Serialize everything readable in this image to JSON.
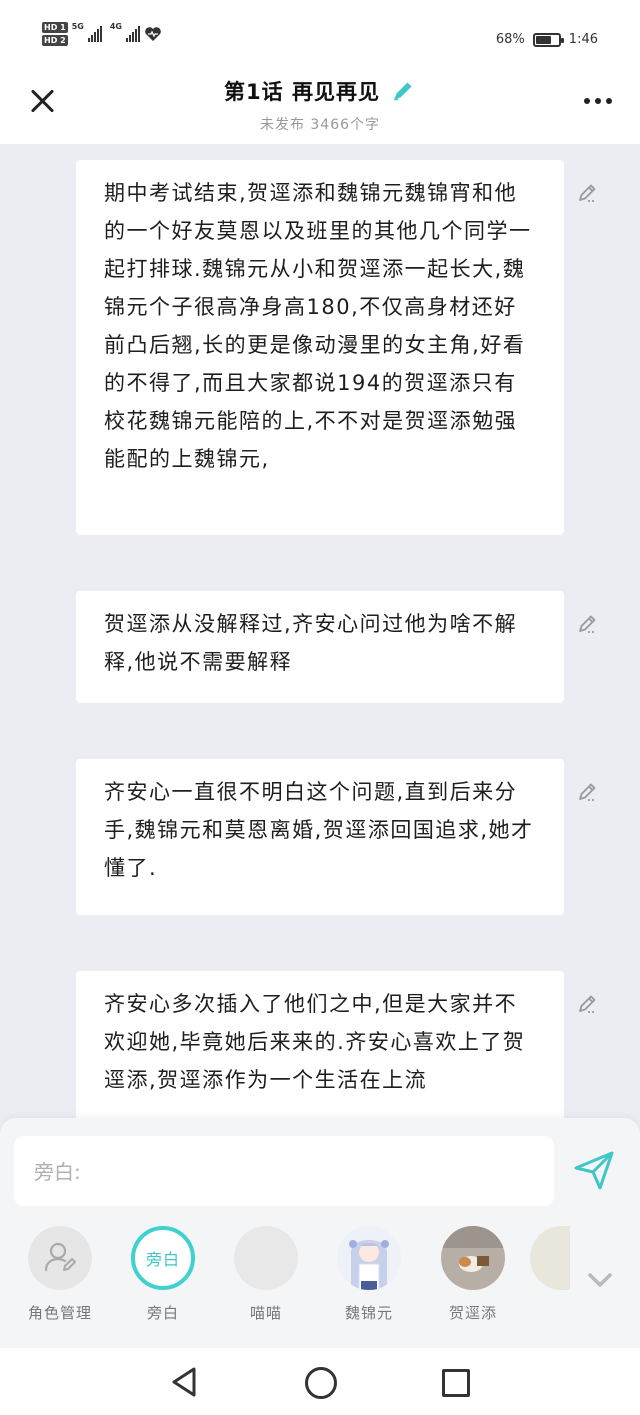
{
  "status_bar": {
    "hd1": "HD 1",
    "hd2": "HD 2",
    "network1": "5G",
    "network2": "4G",
    "battery_percent": "68%",
    "battery_level": 0.68,
    "time": "1:46"
  },
  "header": {
    "title": "第1话 再见再见",
    "subtitle": "未发布 3466个字"
  },
  "paragraphs": [
    {
      "text": "期中考试结束,贺逕添和魏锦元魏锦宵和他的一个好友莫恩以及班里的其他几个同学一起打排球.魏锦元从小和贺逕添一起长大,魏锦元个子很高净身高180,不仅高身材还好前凸后翘,长的更是像动漫里的女主角,好看的不得了,而且大家都说194的贺逕添只有校花魏锦元能陪的上,不不对是贺逕添勉强能配的上魏锦元,"
    },
    {
      "text": "贺逕添从没解释过,齐安心问过他为啥不解释,他说不需要解释"
    },
    {
      "text": "齐安心一直很不明白这个问题,直到后来分手,魏锦元和莫恩离婚,贺逕添回国追求,她才懂了."
    },
    {
      "text": "齐安心多次插入了他们之中,但是大家并不欢迎她,毕竟她后来来的.齐安心喜欢上了贺逕添,贺逕添作为一个生活在上流"
    }
  ],
  "composer": {
    "placeholder": "旁白:"
  },
  "roles": [
    {
      "label": "角色管理",
      "icon": "user-edit-icon"
    },
    {
      "label": "旁白",
      "avatar_text": "旁白"
    },
    {
      "label": "喵喵"
    },
    {
      "label": "魏锦元"
    },
    {
      "label": "贺逕添"
    }
  ],
  "colors": {
    "accent": "#40d0d0",
    "send": "#3fc6c6",
    "background": "#ebedf2"
  }
}
